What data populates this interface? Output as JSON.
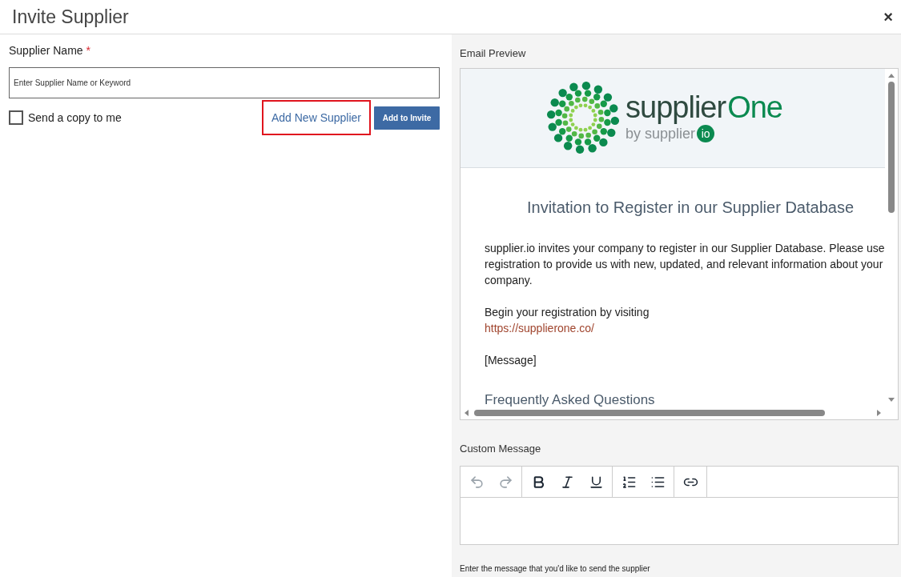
{
  "dialog": {
    "title": "Invite Supplier",
    "close": "×"
  },
  "supplier_name": {
    "label": "Supplier Name",
    "required_mark": "*",
    "placeholder": "Enter Supplier Name or Keyword"
  },
  "send_copy": {
    "label": "Send a copy to me",
    "checked": false
  },
  "add_new_supplier": {
    "label": "Add New Supplier",
    "highlighted": true
  },
  "add_to_invite": {
    "label": "Add to Invite"
  },
  "email_preview": {
    "label": "Email Preview",
    "logo": {
      "name_part_1": "supplier",
      "name_part_2": "One",
      "byline": "by supplier",
      "badge": "io"
    },
    "heading": "Invitation to Register in our Supplier Database",
    "paragraphs": [
      {
        "kind": "text",
        "text": "supplier.io invites your company to register in our Supplier Database. Please use registration to provide us with new, updated, and relevant information about your company."
      },
      {
        "kind": "text",
        "text": "Begin your registration by visiting",
        "link": "https://supplierone.co/"
      },
      {
        "kind": "text",
        "text": "[Message]"
      },
      {
        "kind": "heading",
        "text": "Frequently Asked Questions"
      }
    ]
  },
  "custom_message": {
    "label": "Custom Message",
    "hint": "Enter the message that you'd like to send the supplier",
    "toolbar": [
      [
        {
          "kind": "undo",
          "disabled": true
        },
        {
          "kind": "redo",
          "disabled": true
        }
      ],
      [
        {
          "kind": "bold",
          "disabled": false
        },
        {
          "kind": "italic",
          "disabled": false
        },
        {
          "kind": "underline",
          "disabled": false
        }
      ],
      [
        {
          "kind": "numbered-list",
          "disabled": false
        },
        {
          "kind": "bulleted-list",
          "disabled": false
        }
      ],
      [
        {
          "kind": "link",
          "disabled": false
        }
      ]
    ]
  }
}
